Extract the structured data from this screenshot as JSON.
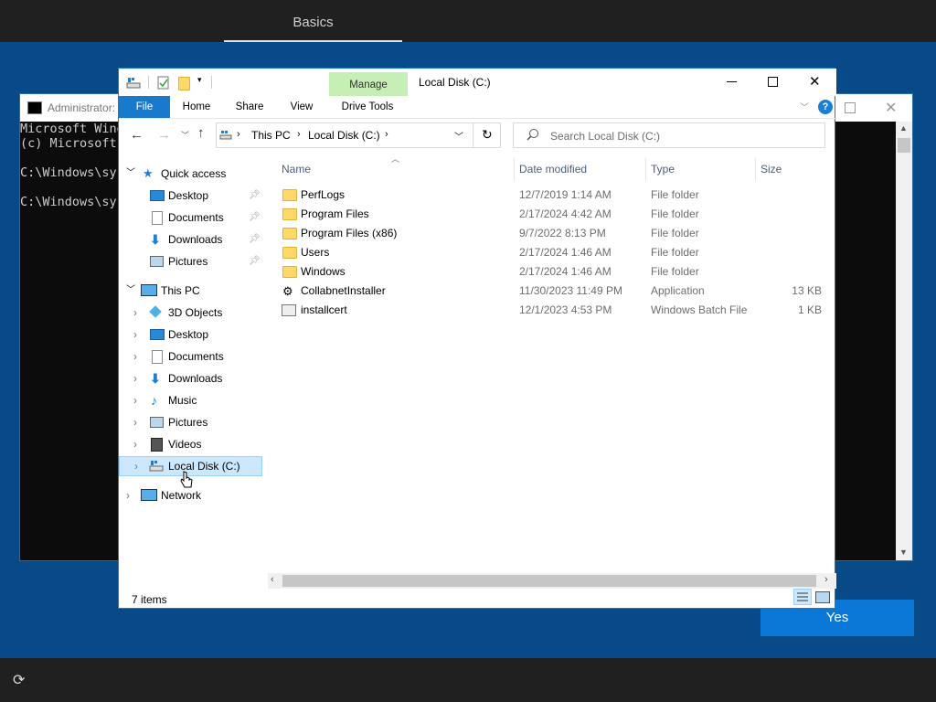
{
  "oobe": {
    "header_tab": "Basics",
    "yes_button": "Yes"
  },
  "cmd": {
    "title": "Administrator:",
    "lines": [
      "Microsoft Wind",
      "(c) Microsoft",
      "",
      "C:\\Windows\\sys",
      "",
      "C:\\Windows\\sys"
    ]
  },
  "explorer": {
    "title": "Local Disk (C:)",
    "context_tab": "Manage",
    "ribbon_tabs": [
      "File",
      "Home",
      "Share",
      "View",
      "Drive Tools"
    ],
    "breadcrumb": [
      "This PC",
      "Local Disk (C:)"
    ],
    "search_placeholder": "Search Local Disk (C:)",
    "nav": {
      "quick_access": {
        "label": "Quick access",
        "items": [
          "Desktop",
          "Documents",
          "Downloads",
          "Pictures"
        ]
      },
      "this_pc": {
        "label": "This PC",
        "items": [
          "3D Objects",
          "Desktop",
          "Documents",
          "Downloads",
          "Music",
          "Pictures",
          "Videos",
          "Local Disk (C:)"
        ]
      },
      "network": "Network"
    },
    "columns": [
      "Name",
      "Date modified",
      "Type",
      "Size"
    ],
    "files": [
      {
        "name": "PerfLogs",
        "date": "12/7/2019 1:14 AM",
        "type": "File folder",
        "size": "",
        "icon": "folder-icon"
      },
      {
        "name": "Program Files",
        "date": "2/17/2024 4:42 AM",
        "type": "File folder",
        "size": "",
        "icon": "folder-icon"
      },
      {
        "name": "Program Files (x86)",
        "date": "9/7/2022 8:13 PM",
        "type": "File folder",
        "size": "",
        "icon": "folder-icon"
      },
      {
        "name": "Users",
        "date": "2/17/2024 1:46 AM",
        "type": "File folder",
        "size": "",
        "icon": "folder-icon"
      },
      {
        "name": "Windows",
        "date": "2/17/2024 1:46 AM",
        "type": "File folder",
        "size": "",
        "icon": "folder-icon"
      },
      {
        "name": "CollabnetInstaller",
        "date": "11/30/2023 11:49 PM",
        "type": "Application",
        "size": "13 KB",
        "icon": "application-icon"
      },
      {
        "name": "installcert",
        "date": "12/1/2023 4:53 PM",
        "type": "Windows Batch File",
        "size": "1 KB",
        "icon": "batch-file-icon"
      }
    ],
    "status": "7 items"
  }
}
